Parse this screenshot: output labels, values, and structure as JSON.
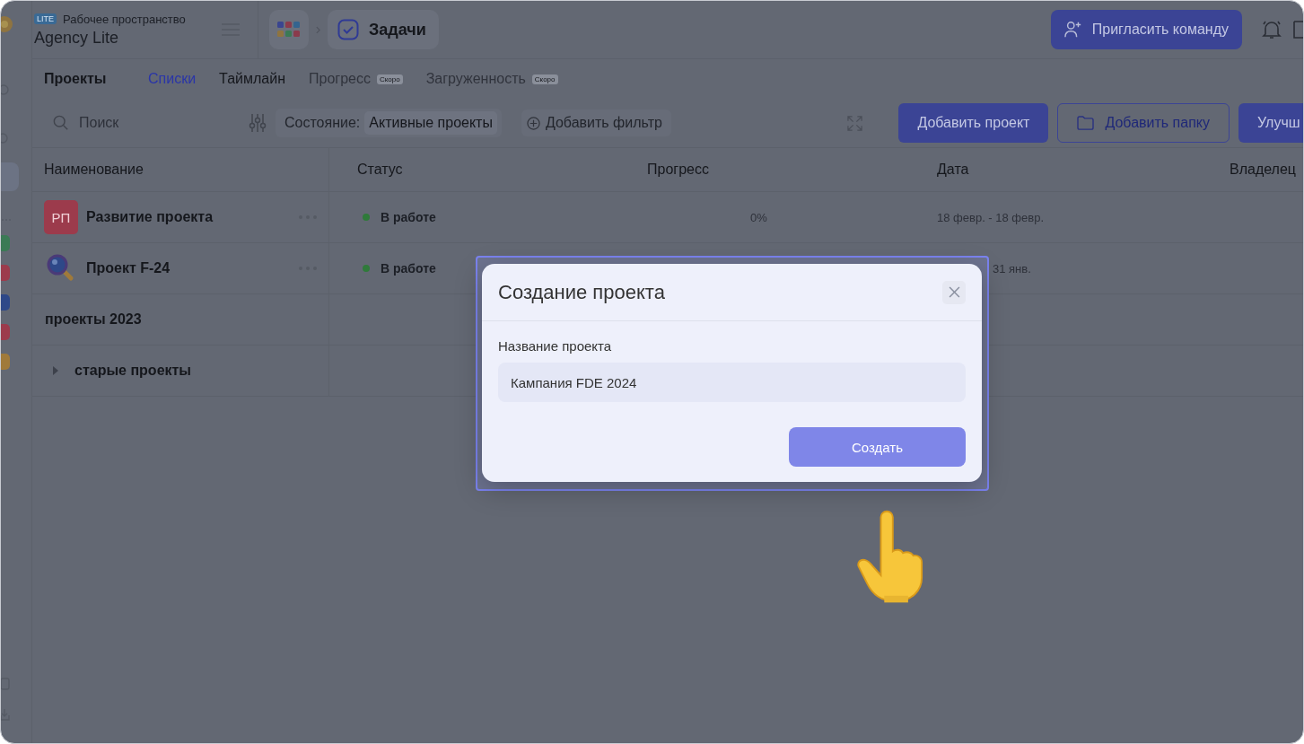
{
  "workspace": {
    "badge": "LITE",
    "label": "Рабочее пространство",
    "name": "Agency Lite"
  },
  "breadcrumb": {
    "current": "Задачи"
  },
  "invite_button": "Пригласить команду",
  "page_title": "Проекты",
  "tabs": [
    {
      "label": "Списки",
      "selected": true,
      "disabled": false
    },
    {
      "label": "Таймлайн",
      "selected": false,
      "disabled": false
    },
    {
      "label": "Прогресс",
      "selected": false,
      "disabled": true,
      "badge": "Скоро"
    },
    {
      "label": "Загруженность",
      "selected": false,
      "disabled": true,
      "badge": "Скоро"
    }
  ],
  "toolbar": {
    "search": {
      "placeholder": "Поиск"
    },
    "state_label": "Состояние:",
    "state_value": "Активные проекты",
    "add_filter": "Добавить фильтр",
    "add_project": "Добавить проект",
    "add_folder": "Добавить папку",
    "more_button": "Улучш"
  },
  "sidebar": {
    "projects": [
      {
        "color": "#3b7a55"
      },
      {
        "color": "#9c3b4c"
      },
      {
        "color": "#2e4888"
      },
      {
        "color": "#9c3b4c"
      },
      {
        "color": "#a07a3a"
      }
    ]
  },
  "table": {
    "columns": [
      "Наименование",
      "Статус",
      "Прогресс",
      "Дата",
      "Владелец"
    ],
    "rows": [
      {
        "kind": "project",
        "avatar": {
          "kind": "initials",
          "text": "РП",
          "color": "#9c3b4c"
        },
        "name": "Развитие проекта",
        "status": {
          "text": "В работе",
          "color": "#2f7a3a"
        },
        "progress": "0%",
        "date": "18 февр. - 18 февр."
      },
      {
        "kind": "project",
        "avatar": {
          "kind": "magnifier"
        },
        "name": "Проект F-24",
        "status": {
          "text": "В работе",
          "color": "#2f7a3a"
        },
        "date": "31 янв."
      },
      {
        "kind": "group",
        "name": "проекты 2023",
        "collapsible": false
      },
      {
        "kind": "group",
        "name": "старые проекты",
        "collapsible": true
      }
    ]
  },
  "dialog": {
    "title": "Создание проекта",
    "field_label": "Название проекта",
    "field_value": "Кампания FDE 2024",
    "submit": "Создать"
  }
}
